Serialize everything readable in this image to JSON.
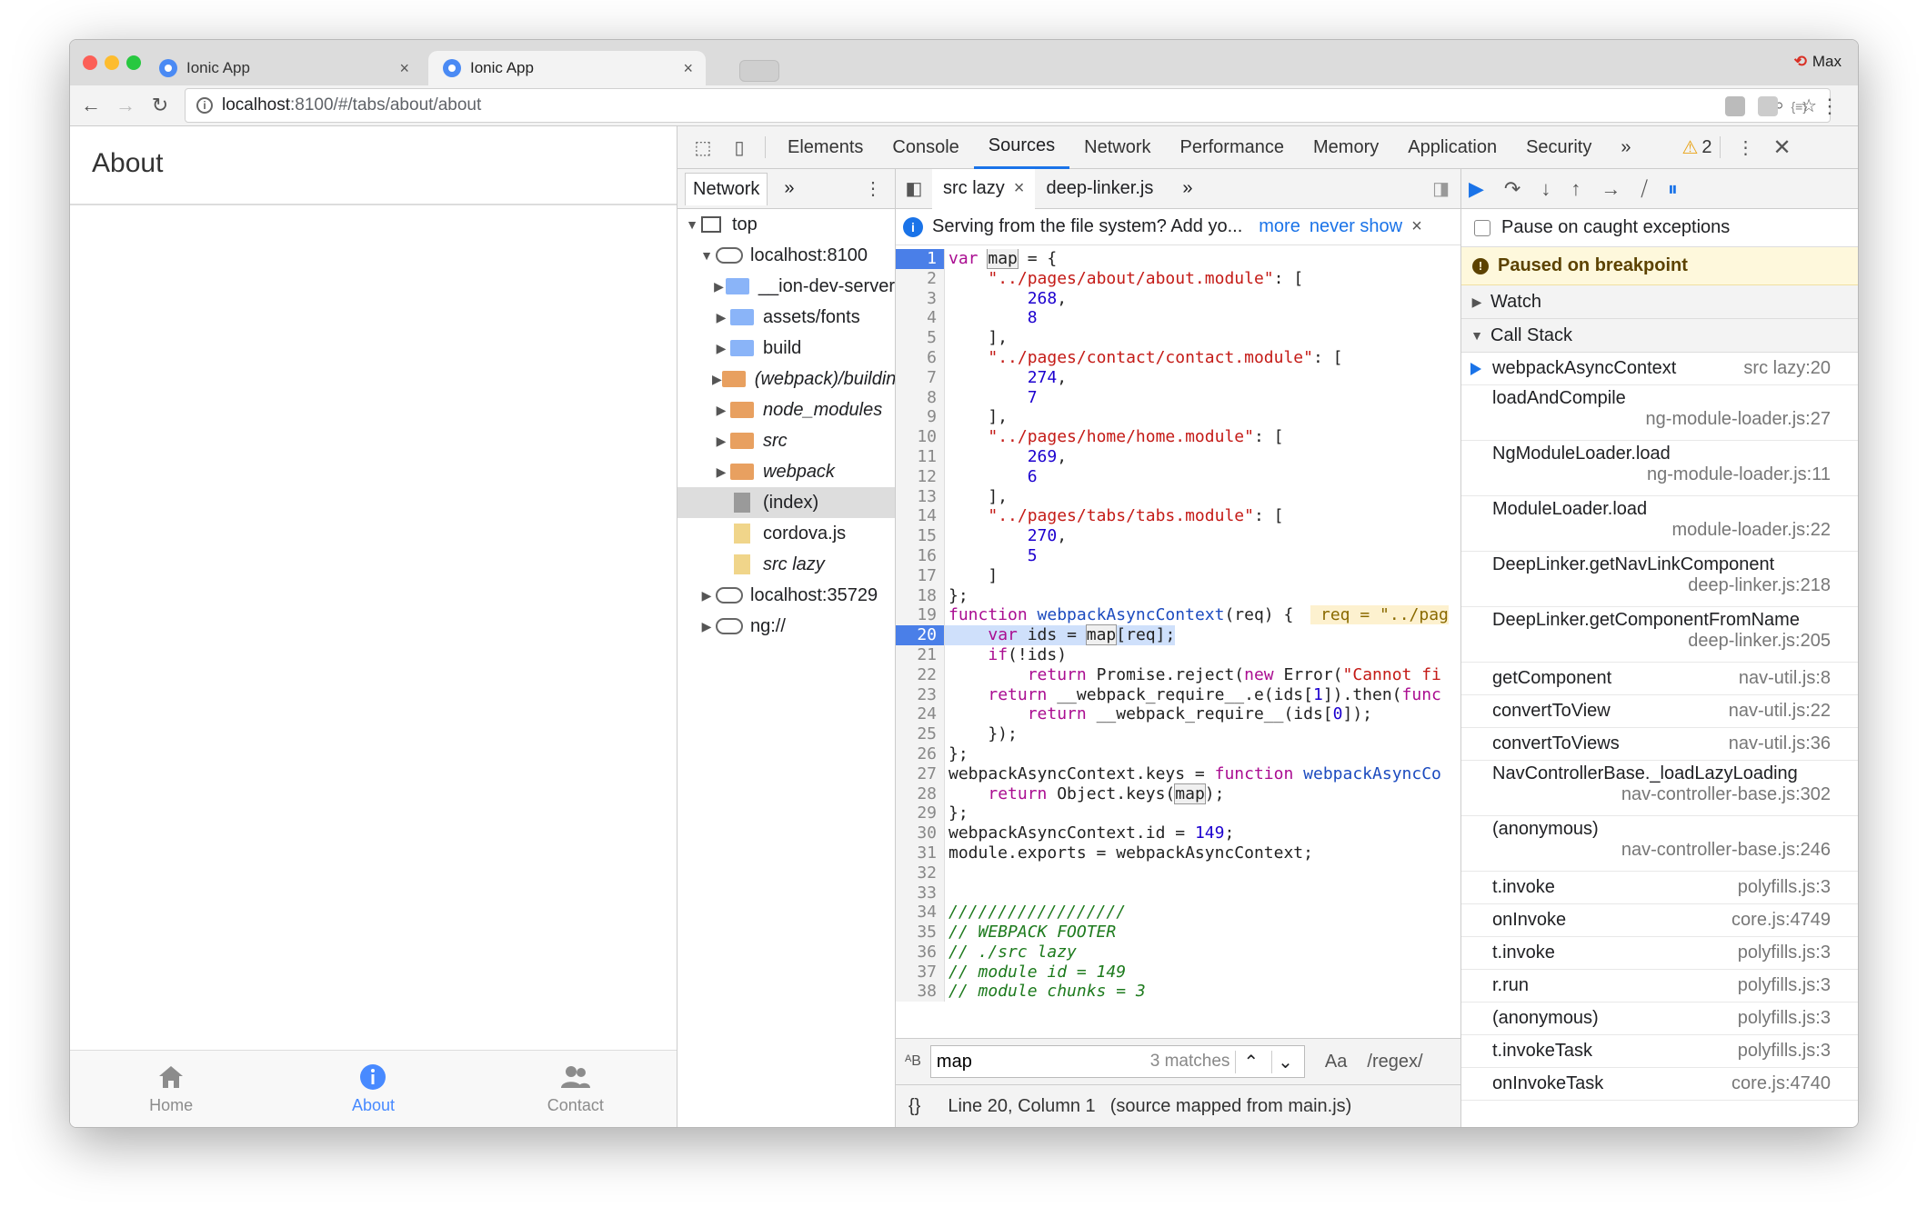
{
  "browser": {
    "tabs": [
      {
        "title": "Ionic App",
        "close": "×"
      },
      {
        "title": "Ionic App",
        "close": "×"
      }
    ],
    "profile": "Max",
    "url_host": "localhost",
    "url_path": ":8100/#/tabs/about/about"
  },
  "app": {
    "header_title": "About",
    "tabs": [
      {
        "label": "Home",
        "icon": "home-icon"
      },
      {
        "label": "About",
        "icon": "info-icon"
      },
      {
        "label": "Contact",
        "icon": "contacts-icon"
      }
    ],
    "accent": "#488aff"
  },
  "devtools": {
    "tabs": [
      "Elements",
      "Console",
      "Sources",
      "Network",
      "Performance",
      "Memory",
      "Application",
      "Security"
    ],
    "selected_tab": "Sources",
    "warning_count": "2",
    "more": "»",
    "navigator": {
      "tab_label": "Network",
      "tree": [
        {
          "label": "top",
          "type": "frame",
          "depth": 0,
          "arrow": "▼"
        },
        {
          "label": "localhost:8100",
          "type": "cloud",
          "depth": 1,
          "arrow": "▼"
        },
        {
          "label": "__ion-dev-server",
          "type": "folder-blue",
          "depth": 2,
          "arrow": "▶"
        },
        {
          "label": "assets/fonts",
          "type": "folder-blue",
          "depth": 2,
          "arrow": "▶"
        },
        {
          "label": "build",
          "type": "folder-blue",
          "depth": 2,
          "arrow": "▶"
        },
        {
          "label": "(webpack)/buildin",
          "type": "folder-orange",
          "depth": 2,
          "arrow": "▶",
          "italic": true
        },
        {
          "label": "node_modules",
          "type": "folder-orange",
          "depth": 2,
          "arrow": "▶",
          "italic": true
        },
        {
          "label": "src",
          "type": "folder-orange",
          "depth": 2,
          "arrow": "▶",
          "italic": true
        },
        {
          "label": "webpack",
          "type": "folder-orange",
          "depth": 2,
          "arrow": "▶",
          "italic": true
        },
        {
          "label": "(index)",
          "type": "file-gray",
          "depth": 2,
          "arrow": "",
          "selected": true
        },
        {
          "label": "cordova.js",
          "type": "file-yellow",
          "depth": 2,
          "arrow": ""
        },
        {
          "label": "src lazy",
          "type": "file-yellow",
          "depth": 2,
          "arrow": "",
          "italic": true
        },
        {
          "label": "localhost:35729",
          "type": "cloud",
          "depth": 1,
          "arrow": "▶"
        },
        {
          "label": "ng://",
          "type": "cloud",
          "depth": 1,
          "arrow": "▶"
        }
      ]
    },
    "editor": {
      "tabs": [
        {
          "label": "src lazy",
          "close": "×",
          "selected": true
        },
        {
          "label": "deep-linker.js",
          "close": "",
          "selected": false
        }
      ],
      "infobar": {
        "text": "Serving from the file system? Add yo...",
        "more": "more",
        "never_show": "never show",
        "close": "×"
      },
      "breakpoint_line": 1,
      "current_line": 20,
      "search": {
        "query": "map",
        "matches": "3 matches",
        "case": "Aa",
        "regex": "/regex/"
      },
      "status": {
        "position": "Line 20, Column 1",
        "mapped": "(source mapped from main.js)",
        "pretty": "{}"
      }
    },
    "debugger": {
      "pause_on_caught": "Pause on caught exceptions",
      "paused_message": "Paused on breakpoint",
      "watch_label": "Watch",
      "callstack_label": "Call Stack",
      "frames": [
        {
          "fn": "webpackAsyncContext",
          "loc": "src lazy:20",
          "current": true,
          "two": false
        },
        {
          "fn": "loadAndCompile",
          "loc": "ng-module-loader.js:27",
          "two": true
        },
        {
          "fn": "NgModuleLoader.load",
          "loc": "ng-module-loader.js:11",
          "two": true
        },
        {
          "fn": "ModuleLoader.load",
          "loc": "module-loader.js:22",
          "two": true
        },
        {
          "fn": "DeepLinker.getNavLinkComponent",
          "loc": "deep-linker.js:218",
          "two": true
        },
        {
          "fn": "DeepLinker.getComponentFromName",
          "loc": "deep-linker.js:205",
          "two": true
        },
        {
          "fn": "getComponent",
          "loc": "nav-util.js:8",
          "two": false
        },
        {
          "fn": "convertToView",
          "loc": "nav-util.js:22",
          "two": false
        },
        {
          "fn": "convertToViews",
          "loc": "nav-util.js:36",
          "two": false
        },
        {
          "fn": "NavControllerBase._loadLazyLoading",
          "loc": "nav-controller-base.js:302",
          "two": true
        },
        {
          "fn": "(anonymous)",
          "loc": "nav-controller-base.js:246",
          "two": true
        },
        {
          "fn": "t.invoke",
          "loc": "polyfills.js:3",
          "two": false
        },
        {
          "fn": "onInvoke",
          "loc": "core.js:4749",
          "two": false
        },
        {
          "fn": "t.invoke",
          "loc": "polyfills.js:3",
          "two": false
        },
        {
          "fn": "r.run",
          "loc": "polyfills.js:3",
          "two": false
        },
        {
          "fn": "(anonymous)",
          "loc": "polyfills.js:3",
          "two": false
        },
        {
          "fn": "t.invokeTask",
          "loc": "polyfills.js:3",
          "two": false
        },
        {
          "fn": "onInvokeTask",
          "loc": "core.js:4740",
          "two": false
        }
      ]
    }
  },
  "code_lines": [
    [
      [
        "k",
        "var "
      ],
      [
        "hl",
        "map"
      ],
      [
        "",
        ""
      ],
      [
        "",
        " = {"
      ]
    ],
    [
      [
        "",
        "    "
      ],
      [
        "s",
        "\"../pages/about/about.module\""
      ],
      [
        "",
        ": ["
      ]
    ],
    [
      [
        "",
        "        "
      ],
      [
        "n",
        "268"
      ],
      [
        "",
        ","
      ]
    ],
    [
      [
        "",
        "        "
      ],
      [
        "n",
        "8"
      ]
    ],
    [
      [
        "",
        "    ],"
      ]
    ],
    [
      [
        "",
        "    "
      ],
      [
        "s",
        "\"../pages/contact/contact.module\""
      ],
      [
        "",
        ": ["
      ]
    ],
    [
      [
        "",
        "        "
      ],
      [
        "n",
        "274"
      ],
      [
        "",
        ","
      ]
    ],
    [
      [
        "",
        "        "
      ],
      [
        "n",
        "7"
      ]
    ],
    [
      [
        "",
        "    ],"
      ]
    ],
    [
      [
        "",
        "    "
      ],
      [
        "s",
        "\"../pages/home/home.module\""
      ],
      [
        "",
        ": ["
      ]
    ],
    [
      [
        "",
        "        "
      ],
      [
        "n",
        "269"
      ],
      [
        "",
        ","
      ]
    ],
    [
      [
        "",
        "        "
      ],
      [
        "n",
        "6"
      ]
    ],
    [
      [
        "",
        "    ],"
      ]
    ],
    [
      [
        "",
        "    "
      ],
      [
        "s",
        "\"../pages/tabs/tabs.module\""
      ],
      [
        "",
        ": ["
      ]
    ],
    [
      [
        "",
        "        "
      ],
      [
        "n",
        "270"
      ],
      [
        "",
        ","
      ]
    ],
    [
      [
        "",
        "        "
      ],
      [
        "n",
        "5"
      ]
    ],
    [
      [
        "",
        "    ]"
      ]
    ],
    [
      [
        "",
        "};"
      ]
    ],
    [
      [
        "k",
        "function "
      ],
      [
        "f",
        "webpackAsyncContext"
      ],
      [
        "",
        "(req) { "
      ],
      [
        "inl",
        " req = \"../pag"
      ]
    ],
    [
      [
        "",
        "    "
      ],
      [
        "k",
        "var "
      ],
      [
        "",
        "ids = "
      ],
      [
        "hl",
        "map"
      ],
      [
        "",
        "[req];"
      ]
    ],
    [
      [
        "",
        "    "
      ],
      [
        "k",
        "if"
      ],
      [
        "",
        "(!ids)"
      ]
    ],
    [
      [
        "",
        "        "
      ],
      [
        "k",
        "return "
      ],
      [
        "",
        "Promise.reject("
      ],
      [
        "k",
        "new "
      ],
      [
        "",
        "Error("
      ],
      [
        "s",
        "\"Cannot fi"
      ]
    ],
    [
      [
        "",
        "    "
      ],
      [
        "k",
        "return "
      ],
      [
        "",
        "__webpack_require__.e(ids["
      ],
      [
        "n",
        "1"
      ],
      [
        "",
        "]).then("
      ],
      [
        "k",
        "func"
      ]
    ],
    [
      [
        "",
        "        "
      ],
      [
        "k",
        "return "
      ],
      [
        "",
        "__webpack_require__(ids["
      ],
      [
        "n",
        "0"
      ],
      [
        "",
        "]);"
      ]
    ],
    [
      [
        "",
        "    });"
      ]
    ],
    [
      [
        "",
        "};"
      ]
    ],
    [
      [
        "",
        "webpackAsyncContext.keys = "
      ],
      [
        "k",
        "function "
      ],
      [
        "f",
        "webpackAsyncCo"
      ]
    ],
    [
      [
        "",
        "    "
      ],
      [
        "k",
        "return "
      ],
      [
        "",
        "Object.keys("
      ],
      [
        "hl",
        "map"
      ],
      [
        "",
        ");"
      ]
    ],
    [
      [
        "",
        "};"
      ]
    ],
    [
      [
        "",
        "webpackAsyncContext.id = "
      ],
      [
        "n",
        "149"
      ],
      [
        "",
        ";"
      ]
    ],
    [
      [
        "",
        "module.exports = webpackAsyncContext;"
      ]
    ],
    [
      [
        "",
        ""
      ]
    ],
    [
      [
        "",
        ""
      ]
    ],
    [
      [
        "c",
        "//////////////////"
      ]
    ],
    [
      [
        "c",
        "// WEBPACK FOOTER"
      ]
    ],
    [
      [
        "c",
        "// ./src lazy"
      ]
    ],
    [
      [
        "c",
        "// module id = 149"
      ]
    ],
    [
      [
        "c",
        "// module chunks = 3"
      ]
    ]
  ]
}
